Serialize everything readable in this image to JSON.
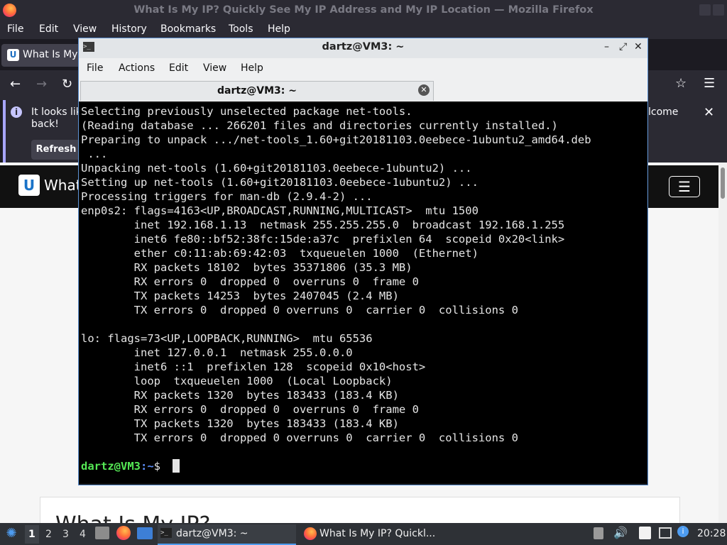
{
  "firefox": {
    "window_title": "What Is My IP? Quickly See My IP Address and My IP Location — Mozilla Firefox",
    "menu": [
      "File",
      "Edit",
      "View",
      "History",
      "Bookmarks",
      "Tools",
      "Help"
    ],
    "tab_title": "What Is My",
    "notice": {
      "text_line1": "It looks lik",
      "text_line2": "back!",
      "text_right": "lcome",
      "refresh_label": "Refresh"
    },
    "page": {
      "site_title": "What",
      "heading": "What Is My IP?"
    }
  },
  "terminal": {
    "window_title": "dartz@VM3: ~",
    "menu": [
      "File",
      "Actions",
      "Edit",
      "View",
      "Help"
    ],
    "tab_label": "dartz@VM3: ~",
    "lines": [
      "Selecting previously unselected package net-tools.",
      "(Reading database ... 266201 files and directories currently installed.)",
      "Preparing to unpack .../net-tools_1.60+git20181103.0eebece-1ubuntu2_amd64.deb",
      " ...",
      "Unpacking net-tools (1.60+git20181103.0eebece-1ubuntu2) ...",
      "Setting up net-tools (1.60+git20181103.0eebece-1ubuntu2) ...",
      "Processing triggers for man-db (2.9.4-2) ...",
      "enp0s2: flags=4163<UP,BROADCAST,RUNNING,MULTICAST>  mtu 1500",
      "        inet 192.168.1.13  netmask 255.255.255.0  broadcast 192.168.1.255",
      "        inet6 fe80::bf52:38fc:15de:a37c  prefixlen 64  scopeid 0x20<link>",
      "        ether c0:11:ab:69:42:03  txqueuelen 1000  (Ethernet)",
      "        RX packets 18102  bytes 35371806 (35.3 MB)",
      "        RX errors 0  dropped 0  overruns 0  frame 0",
      "        TX packets 14253  bytes 2407045 (2.4 MB)",
      "        TX errors 0  dropped 0 overruns 0  carrier 0  collisions 0",
      "",
      "lo: flags=73<UP,LOOPBACK,RUNNING>  mtu 65536",
      "        inet 127.0.0.1  netmask 255.0.0.0",
      "        inet6 ::1  prefixlen 128  scopeid 0x10<host>",
      "        loop  txqueuelen 1000  (Local Loopback)",
      "        RX packets 1320  bytes 183433 (183.4 KB)",
      "        RX errors 0  dropped 0  overruns 0  frame 0",
      "        TX packets 1320  bytes 183433 (183.4 KB)",
      "        TX errors 0  dropped 0 overruns 0  carrier 0  collisions 0",
      ""
    ],
    "prompt": {
      "user_host": "dartz@VM3",
      "path": ":~",
      "symbol": "$ "
    },
    "colors": {
      "prompt_user": "#55e855",
      "prompt_path": "#5b8cf5",
      "background": "#000000"
    }
  },
  "taskbar": {
    "workspaces": [
      "1",
      "2",
      "3",
      "4"
    ],
    "active_workspace": "1",
    "tasks": [
      {
        "label": "dartz@VM3: ~",
        "icon": "terminal-icon"
      },
      {
        "label": "What Is My IP? Quickl...",
        "icon": "firefox-icon"
      }
    ],
    "clock": "20:28"
  }
}
